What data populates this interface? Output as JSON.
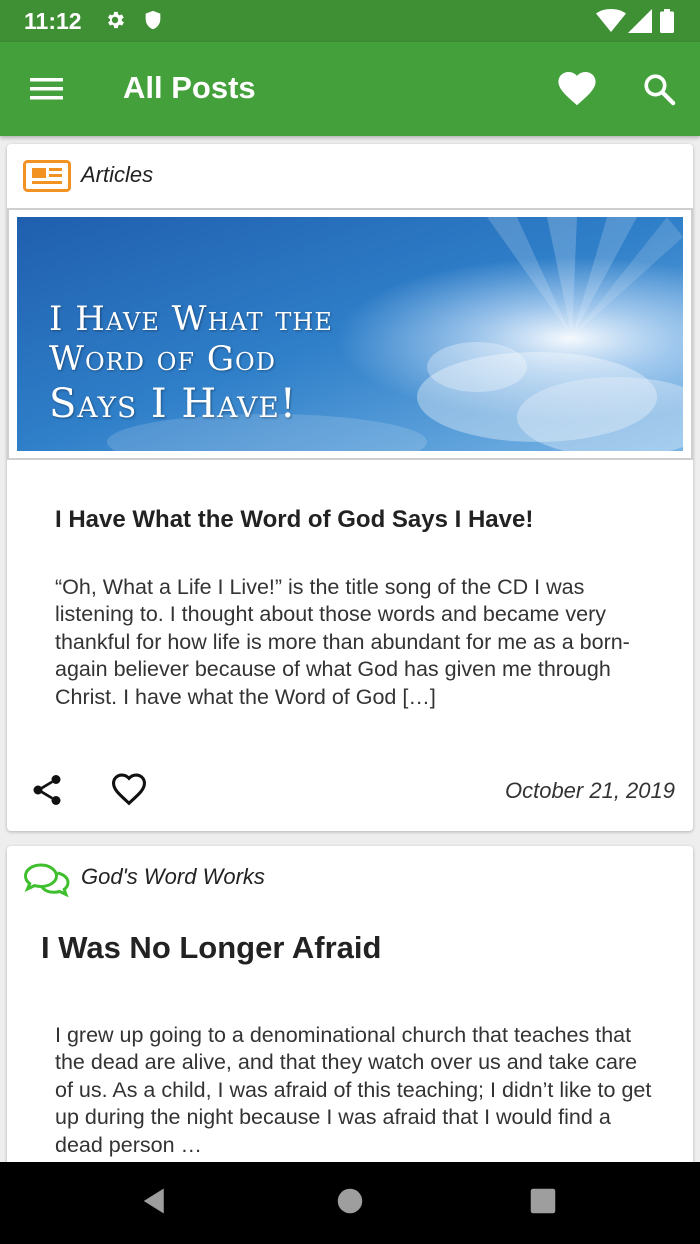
{
  "status_bar": {
    "time": "11:12"
  },
  "app_bar": {
    "title": "All Posts"
  },
  "colors": {
    "primary": "#43a03a",
    "primary_dark": "#3f8f34",
    "articles_icon": "#f29223",
    "works_icon": "#3fbf2e"
  },
  "icons": {
    "status": [
      "gear-icon",
      "shield-icon",
      "wifi-icon",
      "signal-icon",
      "battery-icon"
    ],
    "app_bar": [
      "menu-icon",
      "heart-icon",
      "search-icon"
    ],
    "nav": [
      "back-icon",
      "home-icon",
      "recents-icon"
    ]
  },
  "posts": [
    {
      "category": "Articles",
      "category_icon": "newspaper-icon",
      "image_text": [
        "I Have What the",
        "Word of God",
        "Says I Have!"
      ],
      "title": "I Have What the Word of God Says I Have!",
      "excerpt": "“Oh, What a Life I Live!” is the title song of the CD I was listening to. I thought about those words and became very thankful for how life is more than abundant for me as a born-again believer because of what God has given me through Christ. I have what the Word of God […]",
      "date": "October 21, 2019"
    },
    {
      "category": "God's Word Works",
      "category_icon": "chat-bubbles-icon",
      "title": "I Was No Longer Afraid",
      "excerpt": "I grew up going to a denominational church that teaches that the dead are alive, and that they watch over us and take care of us. As a child, I was afraid of this teaching; I didn’t like to get up during the night because I was afraid that I would find a dead person …"
    }
  ]
}
